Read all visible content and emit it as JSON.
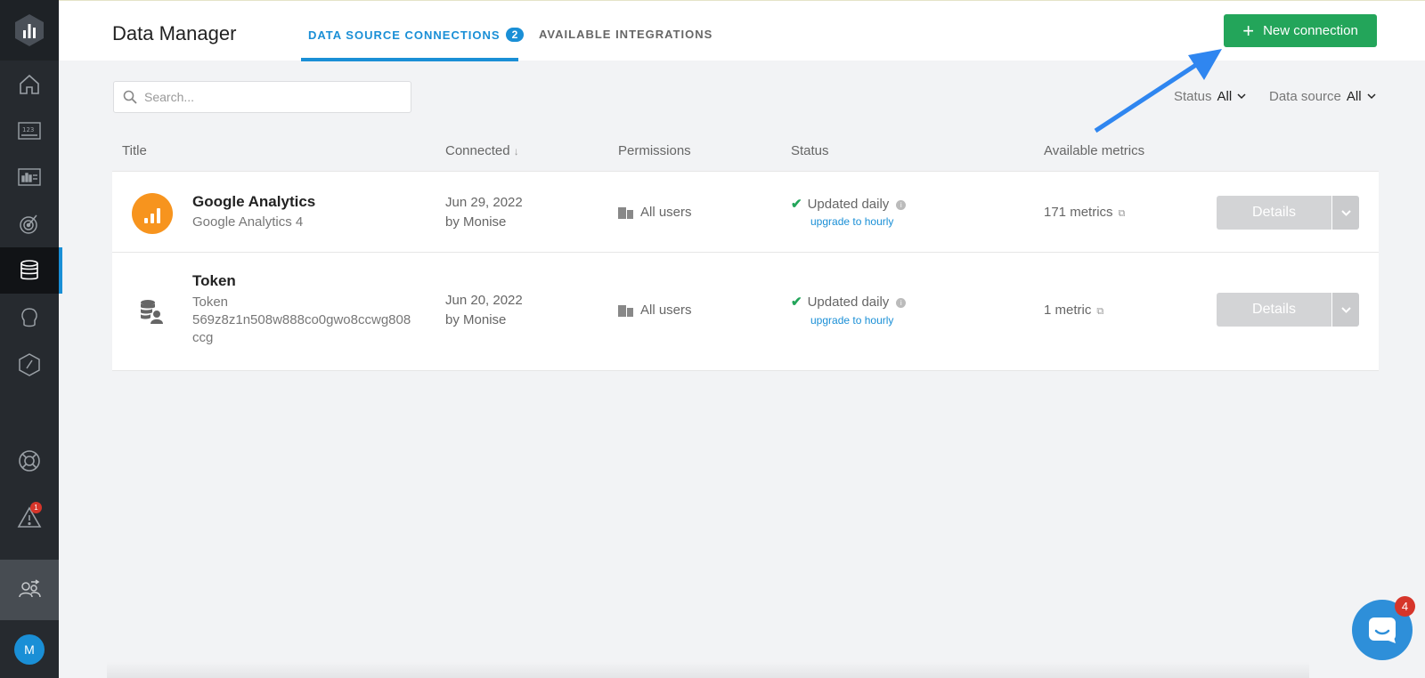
{
  "header": {
    "title": "Data Manager",
    "tabs": [
      {
        "label": "DATA SOURCE CONNECTIONS",
        "badge": "2"
      },
      {
        "label": "AVAILABLE INTEGRATIONS"
      }
    ],
    "new_connection_label": "New connection"
  },
  "search": {
    "placeholder": "Search..."
  },
  "filters": {
    "status_label": "Status",
    "status_value": "All",
    "source_label": "Data source",
    "source_value": "All"
  },
  "table": {
    "columns": [
      "Title",
      "Connected",
      "Permissions",
      "Status",
      "Available metrics"
    ],
    "sort_indicator": "↓",
    "rows": [
      {
        "title": "Google Analytics",
        "subtitle": "Google Analytics 4",
        "connected_date": "Jun 29, 2022",
        "connected_by": "by Monise",
        "permissions": "All users",
        "status": "Updated daily",
        "upgrade": "upgrade to hourly",
        "metrics": "171 metrics",
        "details": "Details"
      },
      {
        "title": "Token",
        "subtitle_line1": "Token",
        "subtitle_line2": "569z8z1n508w888co0gwo8ccwg808",
        "subtitle_line3": "ccg",
        "connected_date": "Jun 20, 2022",
        "connected_by": "by Monise",
        "permissions": "All users",
        "status": "Updated daily",
        "upgrade": "upgrade to hourly",
        "metrics": "1 metric",
        "details": "Details"
      }
    ]
  },
  "sidebar": {
    "items": [
      "home-icon",
      "numbers-icon",
      "dashboard-icon",
      "goals-icon",
      "database-icon",
      "ideas-icon",
      "speed-icon",
      "help-icon",
      "alerts-icon",
      "people-icon"
    ],
    "alerts_count": "1",
    "avatar_initial": "M"
  },
  "chat": {
    "badge": "4"
  },
  "colors": {
    "accent": "#1a8fd6",
    "green": "#23a55a",
    "sidebar": "#262a2f",
    "orange": "#f7941e"
  }
}
